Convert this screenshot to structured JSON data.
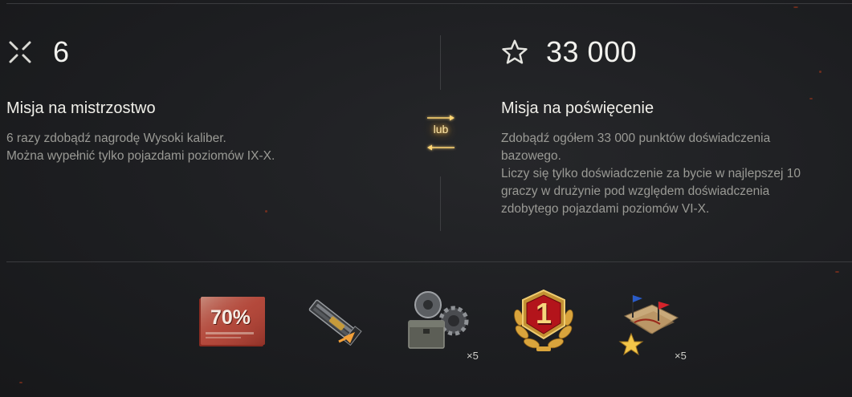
{
  "left_mission": {
    "count_value": "6",
    "count_icon": "crossed-swords-icon",
    "title": "Misja na mistrzostwo",
    "description_lines": [
      "6 razy zdobądź nagrodę Wysoki kaliber.",
      "Można wypełnić tylko pojazdami poziomów IX-X."
    ]
  },
  "separator": {
    "label": "lub",
    "icon": "swap-arrows-icon"
  },
  "right_mission": {
    "xp_value": "33 000",
    "xp_icon": "star-outline-icon",
    "title": "Misja na poświęcenie",
    "description_lines": [
      "Zdobądź ogółem 33 000 punktów doświadczenia",
      "bazowego.",
      "Liczy się tylko doświadczenie za bycie w najlepszej 10",
      "graczy w drużynie pod względem doświadczenia",
      "zdobytego pojazdami poziomów VI-X."
    ]
  },
  "rewards": [
    {
      "name": "discount-coupon",
      "icon": "discount-70-icon",
      "label": "70%",
      "quantity": ""
    },
    {
      "name": "improved-rammer",
      "icon": "rammer-equipment-icon",
      "label": "",
      "quantity": ""
    },
    {
      "name": "equipment-crate",
      "icon": "crate-gears-icon",
      "label": "",
      "quantity": "×5"
    },
    {
      "name": "rank-medal",
      "icon": "laurel-medal-icon",
      "label": "1",
      "quantity": ""
    },
    {
      "name": "battle-maps",
      "icon": "maps-flags-icon",
      "label": "",
      "quantity": "×5"
    }
  ],
  "colors": {
    "accent_gold": "#f6c25a",
    "medal_red": "#b3141b",
    "text_muted": "#9a9a95"
  }
}
